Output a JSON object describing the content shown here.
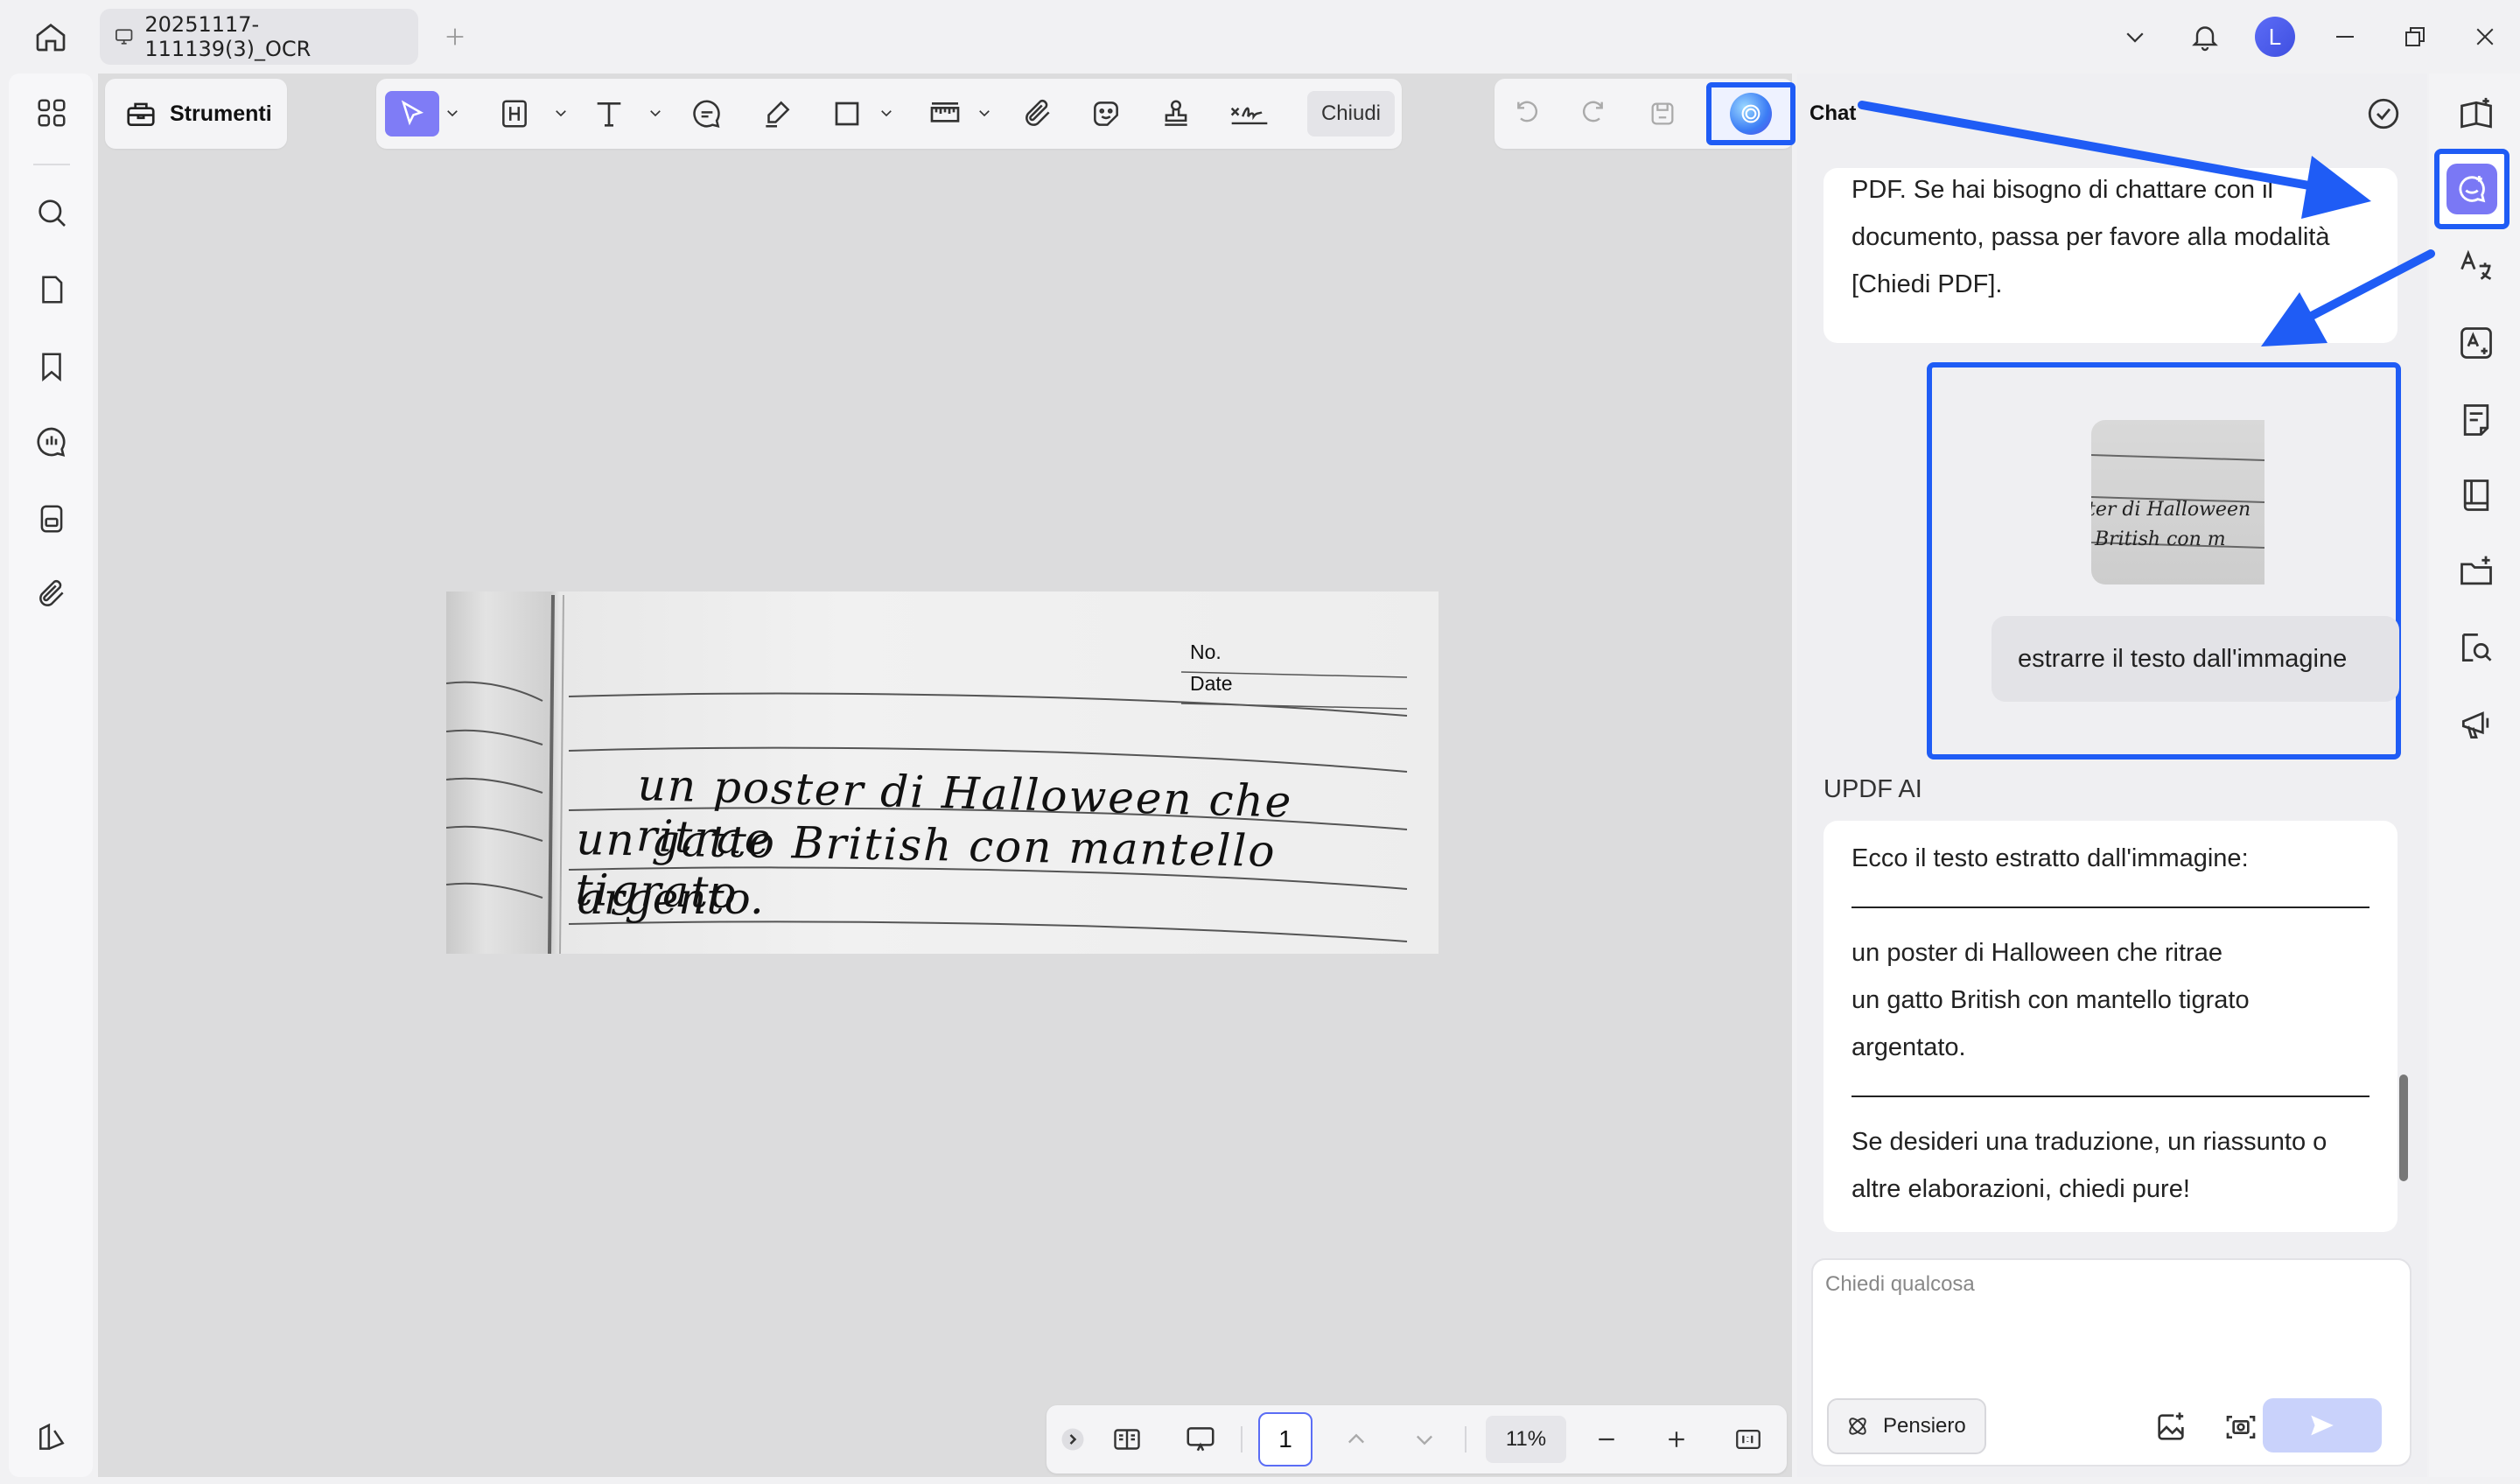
{
  "titlebar": {
    "tab_title": "20251117-111139(3)_OCR",
    "avatar_letter": "L"
  },
  "toolbar": {
    "tools_label": "Strumenti",
    "close_label": "Chiudi"
  },
  "document": {
    "page_fields": {
      "no_label": "No.",
      "date_label": "Date"
    },
    "handwriting": [
      "un poster di Halloween che ritrae",
      "un gatto British con mantello tigrato",
      "argento."
    ]
  },
  "bottom_bar": {
    "page_number": "1",
    "zoom": "11%"
  },
  "chat": {
    "title": "Chat",
    "first_message_lines": [
      "PDF. Se hai bisogno di chattare con il",
      "documento, passa per favore alla modalità",
      "[Chiedi PDF]."
    ],
    "user_message": "estrarre il testo dall'immagine",
    "thumbnail_text": [
      "ter di Halloween",
      "British con m"
    ],
    "ai_label": "UPDF AI",
    "ai_intro": "Ecco il testo estratto dall'immagine:",
    "ai_extracted_lines": [
      "un poster di Halloween che ritrae",
      "un gatto British con mantello tigrato",
      "argentato."
    ],
    "ai_outro_lines": [
      "Se desideri una traduzione, un riassunto o",
      "altre elaborazioni, chiedi pure!"
    ],
    "input_placeholder": "Chiedi qualcosa",
    "thinking_label": "Pensiero"
  },
  "colors": {
    "highlight": "#1f5cf5",
    "active_tool": "#7f7cf6",
    "send_disabled": "#c9d2fb"
  }
}
